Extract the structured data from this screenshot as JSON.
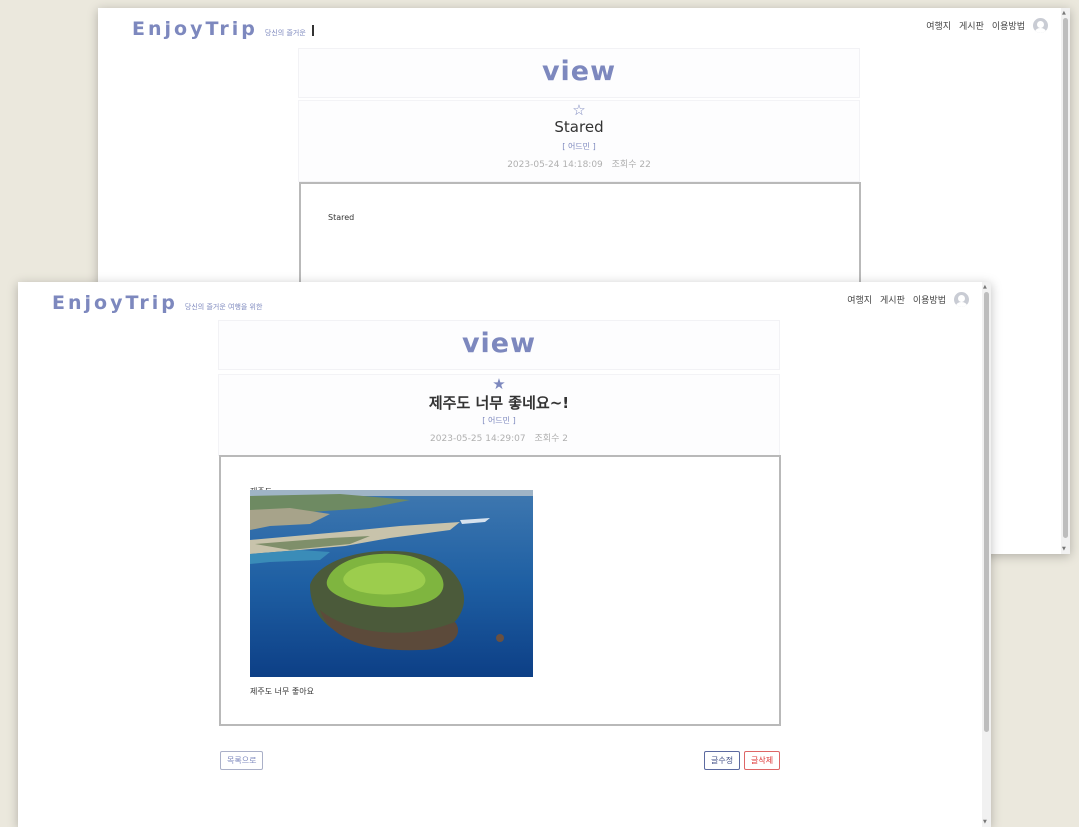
{
  "brand": {
    "logo_text": "EnjoyTrip",
    "tagline_back": "당신의 즐거운",
    "tagline_front": "당신의 즐거운 여행을 위한",
    "color": "#7d88be"
  },
  "nav": {
    "links": [
      "여행지",
      "게시판",
      "이용방법"
    ],
    "avatar_icon": "user-avatar-icon"
  },
  "back_window": {
    "banner": "view",
    "star_icon": "star-outline-icon",
    "star_glyph": "☆",
    "title": "Stared",
    "author": "[ 어드민 ]",
    "date": "2023-05-24 14:18:09",
    "views": "조회수 22",
    "content": "Stared"
  },
  "front_window": {
    "banner": "view",
    "star_icon": "star-filled-icon",
    "star_glyph": "★",
    "title": "제주도 너무 좋네요~!",
    "author": "[ 어드민 ]",
    "date": "2023-05-25 14:29:07",
    "views": "조회수 2",
    "content_top": "제주도",
    "content_bottom": "제주도 너무 좋아요",
    "buttons": {
      "list": "목록으로",
      "edit": "글수정",
      "delete": "글삭제"
    }
  }
}
